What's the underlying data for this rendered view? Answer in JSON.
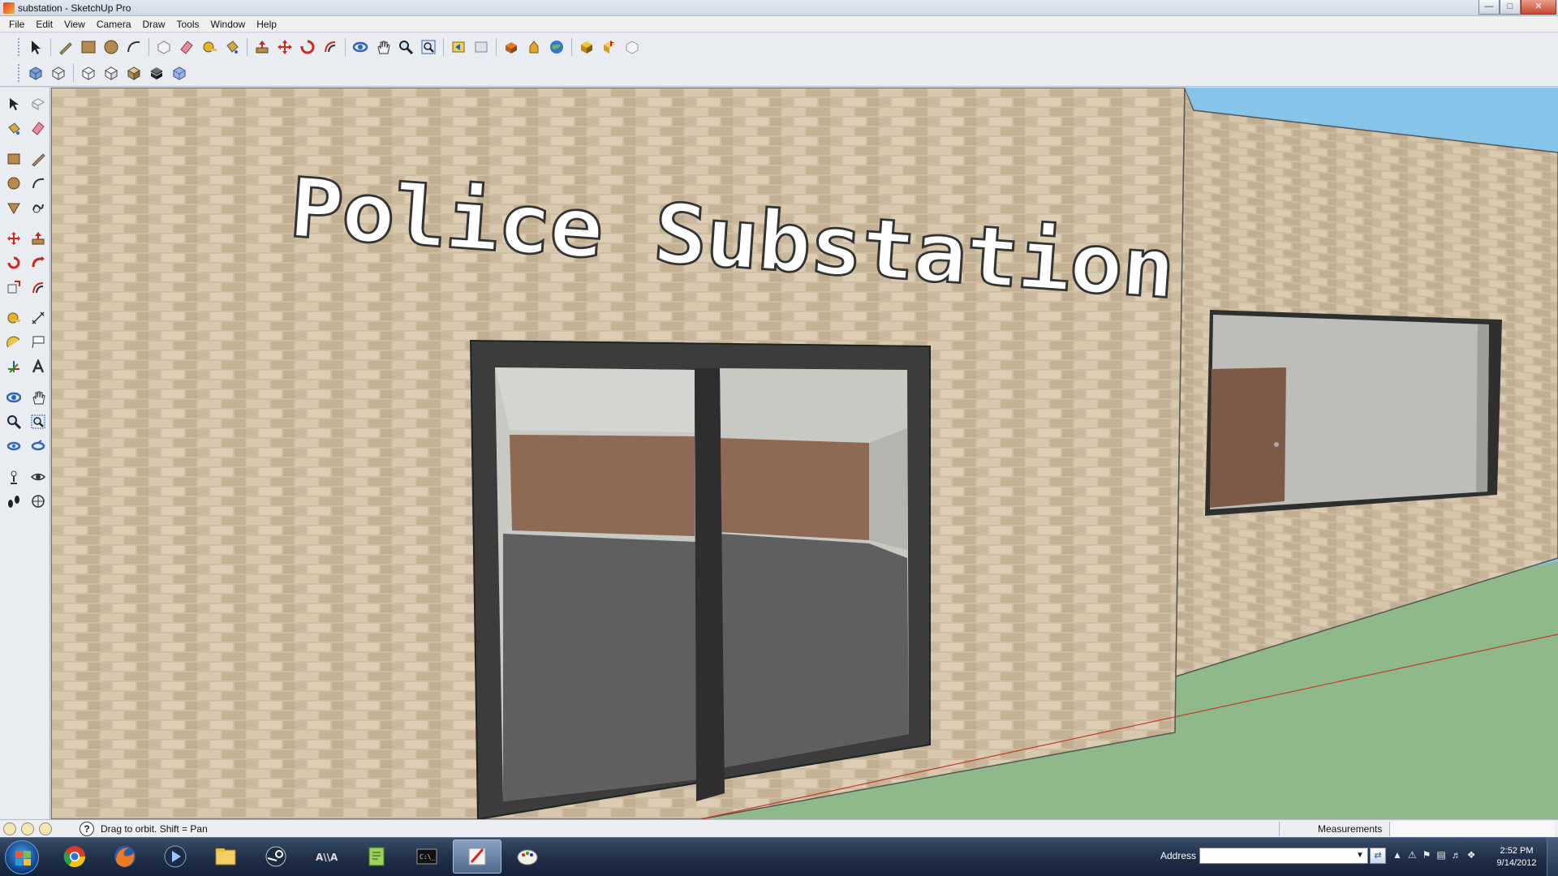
{
  "window": {
    "title": "substation - SketchUp Pro",
    "controls": [
      "minimize",
      "maximize",
      "close"
    ]
  },
  "menu": [
    "File",
    "Edit",
    "View",
    "Camera",
    "Draw",
    "Tools",
    "Window",
    "Help"
  ],
  "toolbar_row1": [
    "select-icon",
    "pencil-icon",
    "rectangle-icon",
    "circle-icon",
    "arc-icon",
    "make-component-icon",
    "eraser-icon",
    "tape-measure-icon",
    "paint-bucket-icon",
    "push-pull-icon",
    "move-icon",
    "rotate-icon",
    "offset-icon",
    "orbit-icon",
    "pan-icon",
    "zoom-icon",
    "zoom-extents-icon",
    "previous-view-icon",
    "next-view-icon",
    "get-models-icon",
    "share-model-icon",
    "google-earth-icon",
    "get-components-icon",
    "share-component-icon",
    "extension-icon"
  ],
  "toolbar_row2": [
    "xray-icon",
    "wireframe-icon",
    "hidden-line-icon",
    "shaded-icon",
    "shaded-texture-icon",
    "monochrome-icon",
    "back-edges-icon"
  ],
  "palette": [
    "select-icon",
    "make-component-icon",
    "paint-bucket-icon",
    "eraser-icon",
    "rectangle-icon",
    "line-icon",
    "circle-icon",
    "arc-icon",
    "polygon-icon",
    "freehand-icon",
    "move-icon",
    "push-pull-icon",
    "rotate-icon",
    "follow-me-icon",
    "scale-icon",
    "offset-icon",
    "tape-measure-icon",
    "dimension-icon",
    "protractor-icon",
    "text-icon",
    "axes-icon",
    "3d-text-icon",
    "orbit-icon",
    "pan-icon",
    "zoom-icon",
    "zoom-window-icon",
    "previous-icon",
    "zoom-extents-icon",
    "position-camera-icon",
    "look-around-icon",
    "walk-icon",
    "section-plane-icon"
  ],
  "scene": {
    "sign_text": "Police Substation",
    "colors": {
      "brick": "#c9b89f",
      "sky": "#86c4ea",
      "grass": "#8fb98a",
      "door_frame": "#3a3a3a",
      "interior_wood": "#8e6a55",
      "interior_floor": "#5f5f5f"
    }
  },
  "status": {
    "hint": "Drag to orbit.  Shift = Pan",
    "measurements_label": "Measurements",
    "measurements_value": ""
  },
  "taskbar": {
    "tasks": [
      "chrome-icon",
      "firefox-icon",
      "media-player-icon",
      "explorer-icon",
      "steam-icon",
      "arma-icon",
      "notepad-icon",
      "cmd-icon",
      "sketchup-icon",
      "paint-icon"
    ],
    "active_task": "sketchup-icon",
    "address_label": "Address",
    "address_value": "",
    "time": "2:52 PM",
    "date": "9/14/2012"
  }
}
